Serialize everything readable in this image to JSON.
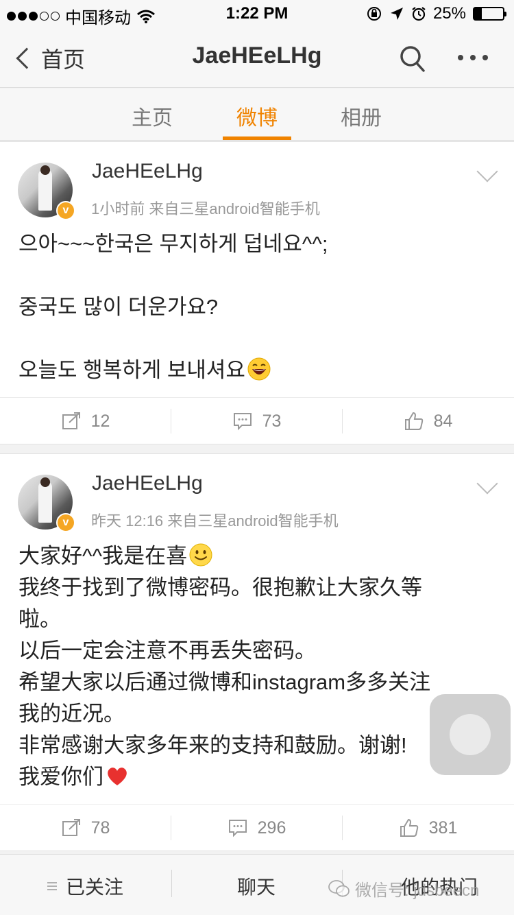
{
  "status_bar": {
    "carrier": "中国移动",
    "time": "1:22 PM",
    "battery_percent": "25%",
    "battery_level": 0.25
  },
  "nav": {
    "back_label": "首页",
    "title": "JaeHEeLHg"
  },
  "tabs": [
    {
      "label": "主页",
      "active": false
    },
    {
      "label": "微博",
      "active": true
    },
    {
      "label": "相册",
      "active": false
    }
  ],
  "posts": [
    {
      "username": "JaeHEeLHg",
      "meta": "1小时前  来自三星android智能手机",
      "lines": [
        "으아~~~한국은 무지하게 덥네요^^;",
        "",
        "중국도 많이 더운가요?",
        "",
        "오늘도 행복하게 보내셔요"
      ],
      "reposts": "12",
      "comments": "73",
      "likes": "84"
    },
    {
      "username": "JaeHEeLHg",
      "meta": "昨天 12:16  来自三星android智能手机",
      "lines": [
        "大家好^^我是在喜",
        "我终于找到了微博密码。很抱歉让大家久等",
        "啦。",
        "以后一定会注意不再丢失密码。",
        "希望大家以后通过微博和instagram多多关注",
        "我的近况。",
        "非常感谢大家多年来的支持和鼓励。谢谢!",
        "我爱你们"
      ],
      "reposts": "78",
      "comments": "296",
      "likes": "381"
    }
  ],
  "bottom_bar": {
    "follow_label": "已关注",
    "chat_label": "聊天",
    "hot_label": "他的热门",
    "watermark": "微信号: jdsbeecn"
  },
  "colors": {
    "accent": "#f08300",
    "verified": "#f5a623",
    "heart": "#e8312f"
  }
}
